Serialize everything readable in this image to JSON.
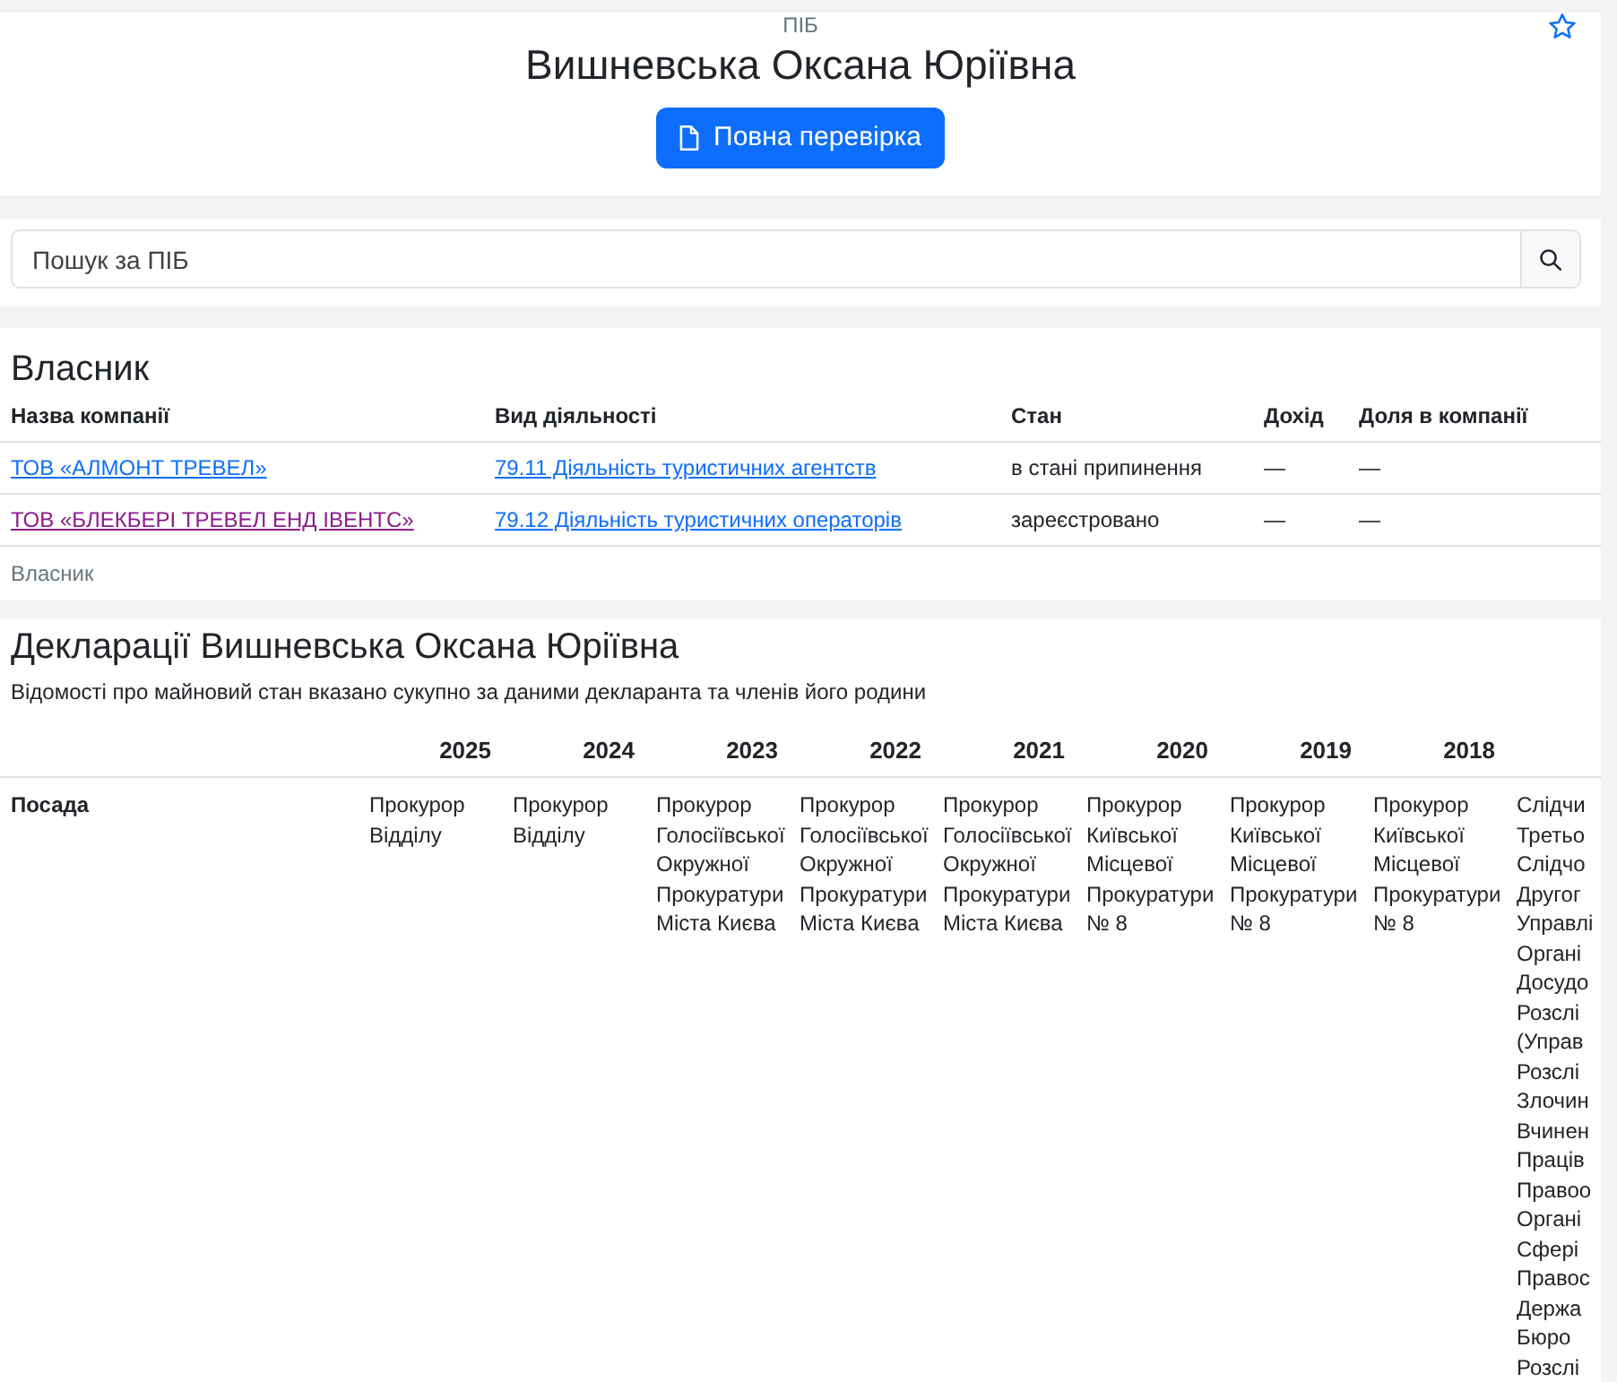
{
  "header": {
    "label": "ПІБ",
    "name": "Вишневська Оксана Юріївна",
    "button": "Повна перевірка",
    "starred": false
  },
  "search": {
    "placeholder": "Пошук за ПІБ"
  },
  "owner": {
    "title": "Власник",
    "columns": [
      "Назва компанії",
      "Вид діяльності",
      "Стан",
      "Дохід",
      "Доля в компанії"
    ],
    "rows": [
      {
        "company": {
          "text": "ТОВ «АЛМОНТ ТРЕВЕЛ»",
          "visited": false
        },
        "activity": "79.11 Діяльність туристичних агентств",
        "status": "в стані припинення",
        "income": "—",
        "share": "—"
      },
      {
        "company": {
          "text": "ТОВ «БЛЕКБЕРІ ТРЕВЕЛ ЕНД ІВЕНТС»",
          "visited": true
        },
        "activity": "79.12 Діяльність туристичних операторів",
        "status": "зареєстровано",
        "income": "—",
        "share": "—"
      }
    ],
    "caption": "Власник"
  },
  "declarations": {
    "title": "Декларації Вишневська Оксана Юріївна",
    "note": "Відомості про майновий стан вказано сукупно за даними декларанта та членів його родини",
    "years": [
      "2025",
      "2024",
      "2023",
      "2022",
      "2021",
      "2020",
      "2019",
      "2018"
    ],
    "rows": [
      {
        "label": "Посада",
        "cells": [
          "Прокурор Відділу",
          "Прокурор Відділу",
          "Прокурор Голосіївської Окружної Прокуратури Міста Києва",
          "Прокурор Голосіївської Окружної Прокуратури Міста Києва",
          "Прокурор Голосіївської Окружної Прокуратури Міста Києва",
          "Прокурор Київської Місцевої Прокуратури № 8",
          "Прокурор Київської Місцевої Прокуратури № 8",
          "Прокурор Київської Місцевої Прокуратури № 8",
          "Слідчи\nТретьо\nСлідчо\nДругог\nУправлі\nОргані\nДосудо\nРозслі\n(Управ\nРозслі\nЗлочин\nВчинен\nПраців\nПравоо\nОргані\nСфері\nПравос\nДержа\nБюро\nРозслі"
        ]
      }
    ]
  }
}
